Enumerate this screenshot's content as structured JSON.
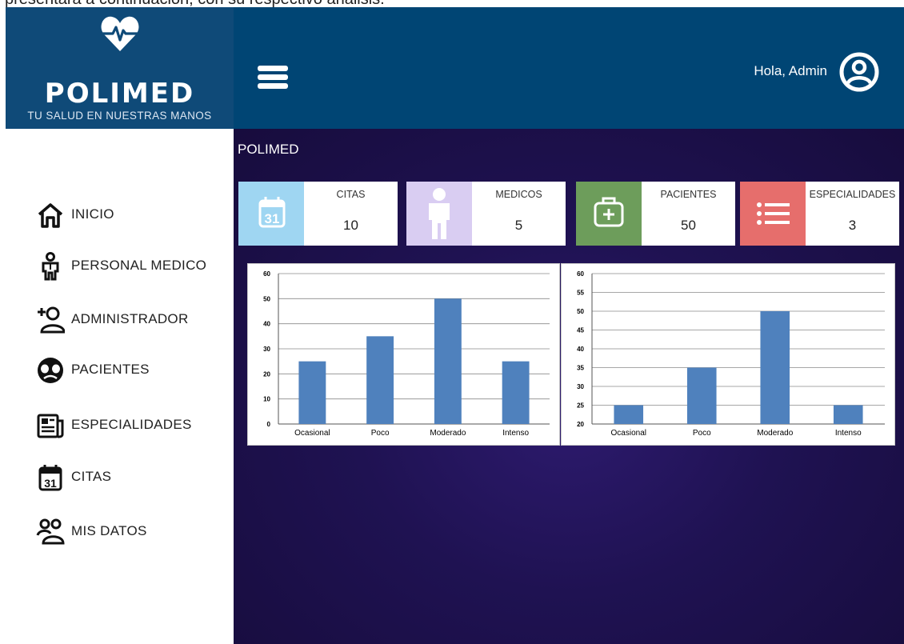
{
  "document_text": "presentará a continuación, con su respectivo análisis.",
  "logo": {
    "name": "POLIMED",
    "tagline": "TU SALUD EN NUESTRAS MANOS",
    "icon": "heart-pulse-icon"
  },
  "header": {
    "greeting": "Hola, Admin",
    "menu_icon": "hamburger-menu-icon",
    "user_icon": "user-circle-icon",
    "bg_color": "#004574"
  },
  "sidebar": {
    "items": [
      {
        "label": "INICIO",
        "icon": "home-icon"
      },
      {
        "label": "PERSONAL MEDICO",
        "icon": "doctor-icon"
      },
      {
        "label": "ADMINISTRADOR",
        "icon": "add-user-icon"
      },
      {
        "label": "PACIENTES",
        "icon": "patient-face-icon"
      },
      {
        "label": "ESPECIALIDADES",
        "icon": "newspaper-icon"
      },
      {
        "label": "CITAS",
        "icon": "calendar-icon"
      },
      {
        "label": "MIS DATOS",
        "icon": "users-icon"
      }
    ]
  },
  "main": {
    "title": "POLIMED",
    "cards": [
      {
        "label": "CITAS",
        "value": "10",
        "icon": "calendar-icon",
        "color": "#9fd6f2"
      },
      {
        "label": "MEDICOS",
        "value": "5",
        "icon": "person-icon",
        "color": "#d9cdf2"
      },
      {
        "label": "PACIENTES",
        "value": "50",
        "icon": "medical-kit-icon",
        "color": "#6d9d5b"
      },
      {
        "label": "ESPECIALIDADES",
        "value": "3",
        "icon": "list-icon",
        "color": "#e66e6c"
      }
    ]
  },
  "chart_data": [
    {
      "type": "bar",
      "categories": [
        "Ocasional",
        "Poco",
        "Moderado",
        "Intenso"
      ],
      "values": [
        25,
        35,
        50,
        25
      ],
      "yticks": [
        "0",
        "10",
        "20",
        "30",
        "40",
        "50",
        "60"
      ],
      "ylim": [
        0,
        60
      ],
      "grid": true,
      "bar_color": "#4f81bd"
    },
    {
      "type": "bar",
      "categories": [
        "Ocasional",
        "Poco",
        "Moderado",
        "Intenso"
      ],
      "values": [
        25,
        35,
        50,
        25
      ],
      "yticks": [
        "20",
        "25",
        "30",
        "35",
        "40",
        "45",
        "50",
        "55",
        "60"
      ],
      "ylim": [
        20,
        60
      ],
      "grid": true,
      "bar_color": "#4f81bd"
    }
  ]
}
